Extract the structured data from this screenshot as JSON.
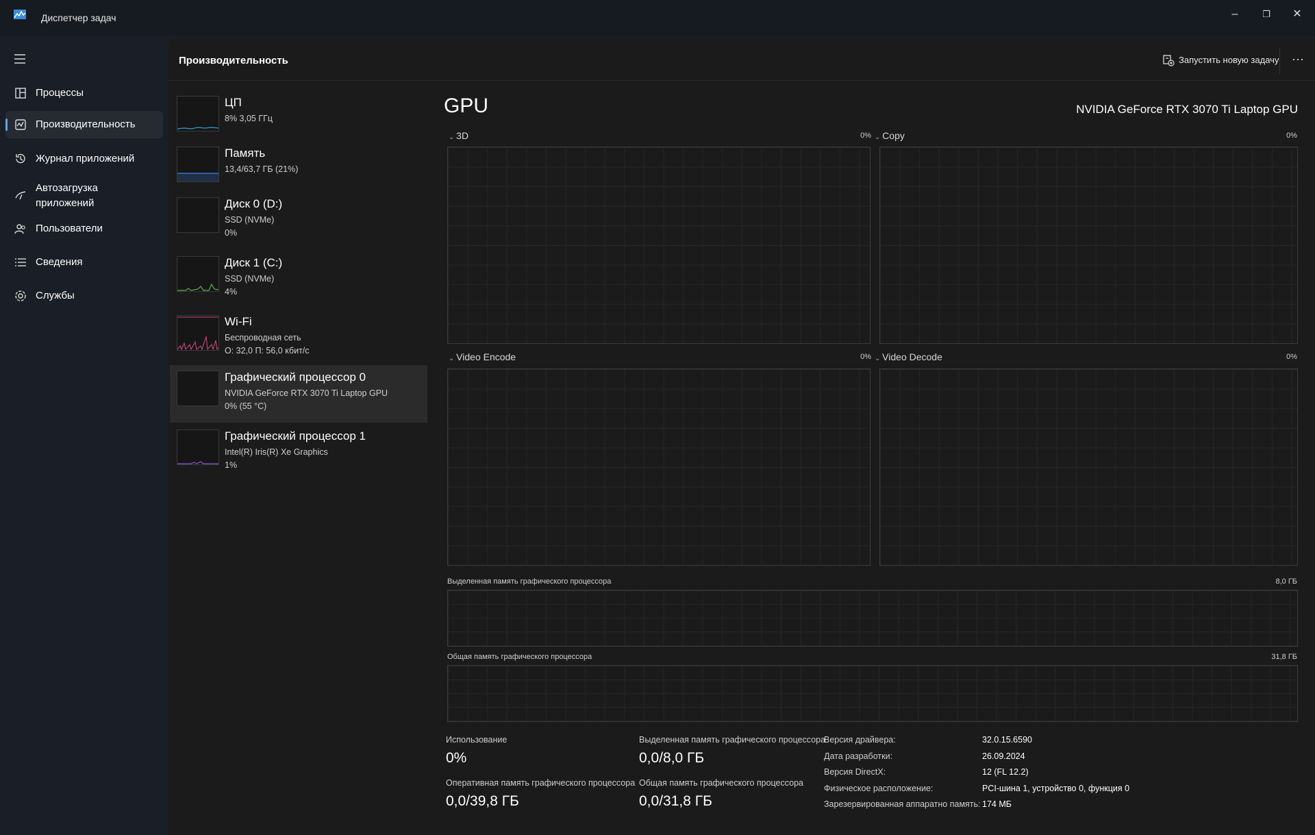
{
  "app": {
    "title": "Диспетчер задач"
  },
  "sidebar": {
    "items": [
      {
        "label": "Процессы",
        "icon": "processes-icon"
      },
      {
        "label": "Производительность",
        "icon": "performance-icon",
        "active": true
      },
      {
        "label": "Журнал приложений",
        "icon": "app-history-icon"
      },
      {
        "label": "Автозагрузка приложений",
        "icon": "startup-apps-icon"
      },
      {
        "label": "Пользователи",
        "icon": "users-icon"
      },
      {
        "label": "Сведения",
        "icon": "details-icon"
      },
      {
        "label": "Службы",
        "icon": "services-icon"
      }
    ]
  },
  "header": {
    "title": "Производительность",
    "run_task": "Запустить новую задачу",
    "more": "···"
  },
  "devices": [
    {
      "name": "ЦП",
      "line1": "8% 3,05 ГГц",
      "line2": "",
      "color": "#2f9fd8"
    },
    {
      "name": "Память",
      "line1": "13,4/63,7 ГБ (21%)",
      "line2": "",
      "color": "#3d7fd9"
    },
    {
      "name": "Диск 0 (D:)",
      "line1": "SSD (NVMe)",
      "line2": "0%",
      "color": "#5bb04a"
    },
    {
      "name": "Диск 1 (C:)",
      "line1": "SSD (NVMe)",
      "line2": "4%",
      "color": "#5bb04a"
    },
    {
      "name": "Wi-Fi",
      "line1": "Беспроводная сеть",
      "line2": "О: 32,0 П: 56,0 кбит/с",
      "color": "#c4477f"
    },
    {
      "name": "Графический процессор 0",
      "line1": "NVIDIA GeForce RTX 3070 Ti Laptop GPU",
      "line2": "0% (55 °C)",
      "color": "#8a5bd6",
      "active": true
    },
    {
      "name": "Графический процессор 1",
      "line1": "Intel(R) Iris(R) Xe Graphics",
      "line2": "1%",
      "color": "#8a5bd6"
    }
  ],
  "gpu": {
    "heading": "GPU",
    "model": "NVIDIA GeForce RTX 3070 Ti Laptop GPU",
    "graphs": [
      {
        "title": "3D",
        "pct": "0%"
      },
      {
        "title": "Copy",
        "pct": "0%"
      },
      {
        "title": "Video Encode",
        "pct": "0%"
      },
      {
        "title": "Video Decode",
        "pct": "0%"
      }
    ],
    "dedicated_mem_title": "Выделенная память графического процессора",
    "dedicated_mem_max": "8,0 ГБ",
    "shared_mem_title": "Общая память графического процессора",
    "shared_mem_max": "31,8 ГБ"
  },
  "stats": {
    "usage_label": "Использование",
    "usage_value": "0%",
    "dedicated_label": "Выделенная память графического процессора",
    "dedicated_value": "0,0/8,0 ГБ",
    "ram_label": "Оперативная память графического процессора",
    "ram_value": "0,0/39,8 ГБ",
    "shared_label": "Общая память графического процессора",
    "shared_value": "0,0/31,8 ГБ"
  },
  "info": [
    {
      "label": "Версия драйвера:",
      "value": "32.0.15.6590"
    },
    {
      "label": "Дата разработки:",
      "value": "26.09.2024"
    },
    {
      "label": "Версия DirectX:",
      "value": "12 (FL 12.2)"
    },
    {
      "label": "Физическое расположение:",
      "value": "PCI-шина 1, устройство 0, функция 0"
    },
    {
      "label": "Зарезервированная аппаратно память:",
      "value": "174 МБ"
    }
  ]
}
